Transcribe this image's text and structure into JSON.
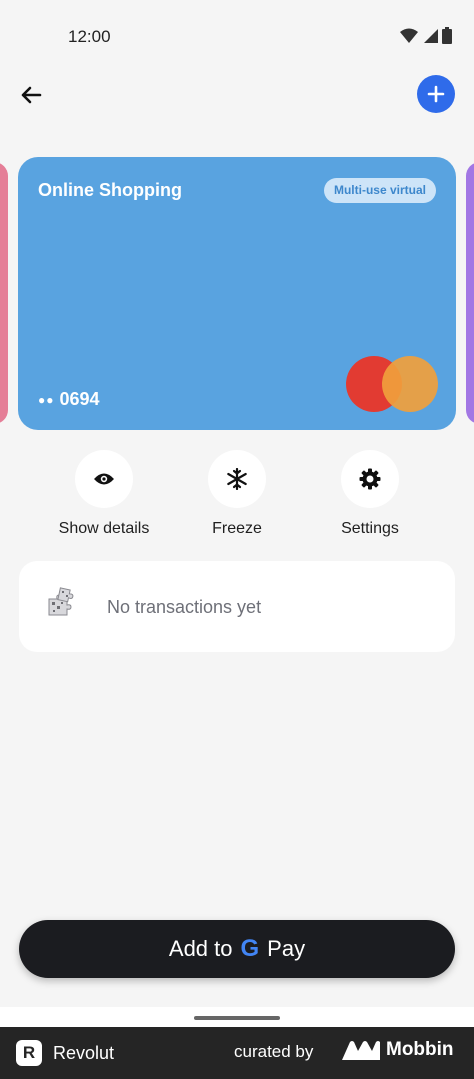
{
  "status_bar": {
    "time": "12:00",
    "icons": [
      "wifi-icon",
      "signal-icon",
      "battery-icon"
    ]
  },
  "header": {
    "back_icon": "arrow-left-icon",
    "add_icon": "plus-icon"
  },
  "card": {
    "name": "Online Shopping",
    "badge": "Multi-use virtual",
    "masked_dots": "●●",
    "last_digits": "0694",
    "network": "mastercard",
    "color": "#59a3e0"
  },
  "actions": [
    {
      "label": "Show details",
      "icon": "eye-icon"
    },
    {
      "label": "Freeze",
      "icon": "snowflake-icon"
    },
    {
      "label": "Settings",
      "icon": "gear-icon"
    }
  ],
  "transactions": {
    "empty_text": "No transactions yet",
    "icon": "puzzle-icon"
  },
  "wallet_button": {
    "prefix": "Add to",
    "g": "G",
    "suffix": "Pay"
  },
  "footer": {
    "app_name": "Revolut",
    "curated_by": "curated by",
    "brand": "Mobbin"
  },
  "colors": {
    "accent": "#2f6bea",
    "card": "#59a3e0",
    "button": "#1b1c20"
  }
}
